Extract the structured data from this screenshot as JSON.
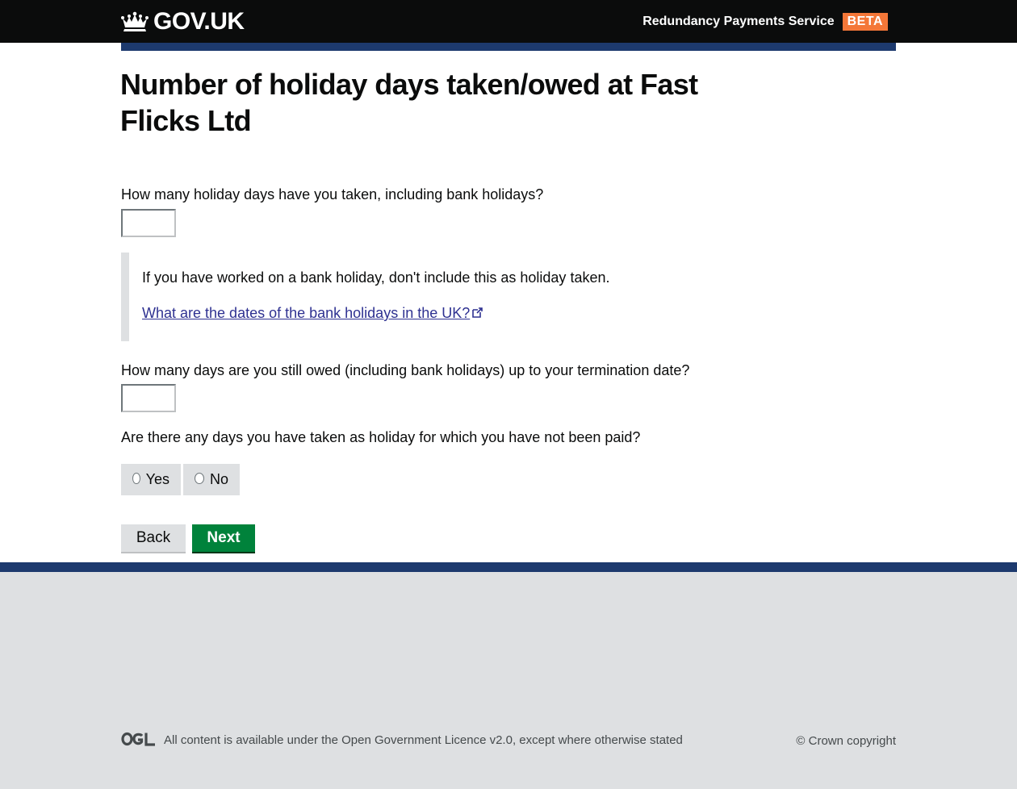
{
  "header": {
    "logo_text": "GOV.UK",
    "service_name": "Redundancy Payments Service",
    "phase_tag": "BETA"
  },
  "page": {
    "title": "Number of holiday days taken/owed at Fast Flicks Ltd"
  },
  "form": {
    "days_taken_label": "How many holiday days have you taken, including bank holidays?",
    "days_taken_value": "",
    "inset_text": "If you have worked on a bank holiday, don't include this as holiday taken.",
    "bank_holidays_link": "What are the dates of the bank holidays in the UK?",
    "days_owed_label": "How many days are you still owed (including bank holidays) up to your termination date?",
    "days_owed_value": "",
    "unpaid_question": "Are there any days you have taken as holiday for which you have not been paid?",
    "radio_yes": "Yes",
    "radio_no": "No",
    "back_button": "Back",
    "next_button": "Next"
  },
  "footer": {
    "licence_prefix": "All content is available under the ",
    "licence_link": "Open Government Licence v2.0",
    "licence_suffix": ", except where otherwise stated",
    "copyright": "© Crown copyright"
  },
  "colors": {
    "header_bg": "#0b0c0c",
    "accent_bar": "#1d3a6e",
    "phase_tag": "#f47738",
    "next_button": "#00823b",
    "link": "#2e3191",
    "footer_bg": "#dee0e2"
  },
  "icons": [
    "crown-icon",
    "external-link-icon",
    "ogl-logo-icon"
  ]
}
